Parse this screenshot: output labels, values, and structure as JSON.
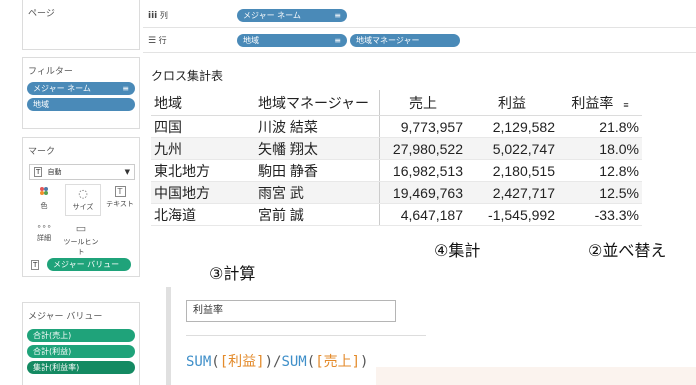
{
  "left_panel": {
    "pages_title": "ページ",
    "filters_title": "フィルター",
    "filters": [
      "メジャー ネーム",
      "地域"
    ],
    "marks_title": "マーク",
    "mark_type": "自動",
    "mark_buttons": [
      {
        "label": "色",
        "icon": "color-icon"
      },
      {
        "label": "サイズ",
        "icon": "size-icon"
      },
      {
        "label": "テキスト",
        "icon": "text-icon"
      },
      {
        "label": "詳細",
        "icon": "detail-icon"
      },
      {
        "label": "ツールヒント",
        "icon": "tooltip-icon"
      }
    ],
    "marks_text_pill": "メジャー バリュー",
    "measure_values_title": "メジャー バリュー",
    "measure_values": [
      "合計(売上)",
      "合計(利益)",
      "集計(利益率)"
    ]
  },
  "shelves": {
    "columns_label": "列",
    "columns_pills": [
      "メジャー ネーム"
    ],
    "rows_label": "行",
    "rows_pills": [
      "地域",
      "地域マネージャー"
    ]
  },
  "view": {
    "title": "クロス集計表",
    "headers": [
      "地域",
      "地域マネージャー",
      "売上",
      "利益",
      "利益率"
    ],
    "rows": [
      [
        "四国",
        "川波 結菜",
        "9,773,957",
        "2,129,582",
        "21.8%"
      ],
      [
        "九州",
        "矢幡 翔太",
        "27,980,522",
        "5,022,747",
        "18.0%"
      ],
      [
        "東北地方",
        "駒田 静香",
        "16,982,513",
        "2,180,515",
        "12.8%"
      ],
      [
        "中国地方",
        "雨宮 武",
        "19,469,763",
        "2,427,717",
        "12.5%"
      ],
      [
        "北海道",
        "宮前 誠",
        "4,647,187",
        "-1,545,992",
        "-33.3%"
      ]
    ]
  },
  "annotations": {
    "aggregate": "④集計",
    "sort": "②並べ替え",
    "calc": "③計算"
  },
  "calc_editor": {
    "field_name": "利益率",
    "formula_parts": [
      "SUM",
      "(",
      "[利益]",
      ")/",
      "SUM",
      "(",
      "[売上]",
      ")"
    ]
  },
  "colors": {
    "pill_blue": "#4a8ab8",
    "pill_green": "#1fa37a",
    "func_blue": "#3f8fc9",
    "field_orange": "#e38a2a"
  }
}
